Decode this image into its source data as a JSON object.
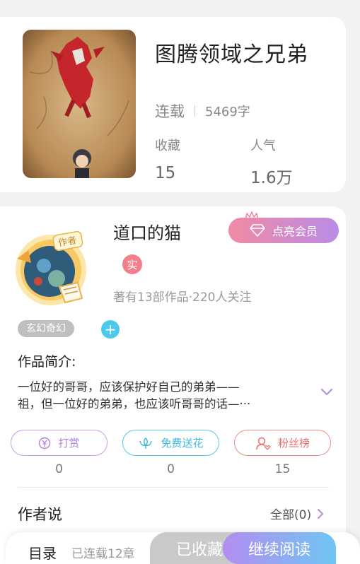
{
  "book": {
    "title": "图腾领域之兄弟",
    "status": "连载",
    "word_count": "5469字",
    "stats": [
      {
        "label": "收藏",
        "value": "15"
      },
      {
        "label": "人气",
        "value": "1.6万"
      }
    ]
  },
  "author": {
    "name": "道口的猫",
    "badge": "实",
    "avatar_tag": "作者",
    "meta": "著有13部作品·220人关注",
    "vip_label": "点亮会员"
  },
  "tags": {
    "genre": "玄幻奇幻",
    "add_symbol": "+"
  },
  "intro": {
    "title": "作品简介:",
    "line1": "一位好的哥哥，应该保护好自己的弟弟——",
    "line2": "祖，但一位好的弟弟，也应该听哥哥的话—···"
  },
  "actions": [
    {
      "label": "打赏",
      "count": "0",
      "icon": "yen-coin-icon"
    },
    {
      "label": "免费送花",
      "count": "0",
      "icon": "flower-icon"
    },
    {
      "label": "粉丝榜",
      "count": "15",
      "icon": "fan-user-icon"
    }
  ],
  "author_says": {
    "title": "作者说",
    "all_link": "全部(0)"
  },
  "bottom_bar": {
    "toc": "目录",
    "chapters": "已连载12章",
    "saved": "已收藏",
    "continue": "继续阅读"
  },
  "colors": {
    "vip_gradient_start": "#f28aa3",
    "vip_gradient_end": "#b98ce8",
    "read_gradient_start": "#b48df0",
    "read_gradient_end": "#6fc6f4",
    "reward": "#b07fe0",
    "flower": "#3fb8de",
    "fans": "#e86f6f"
  }
}
